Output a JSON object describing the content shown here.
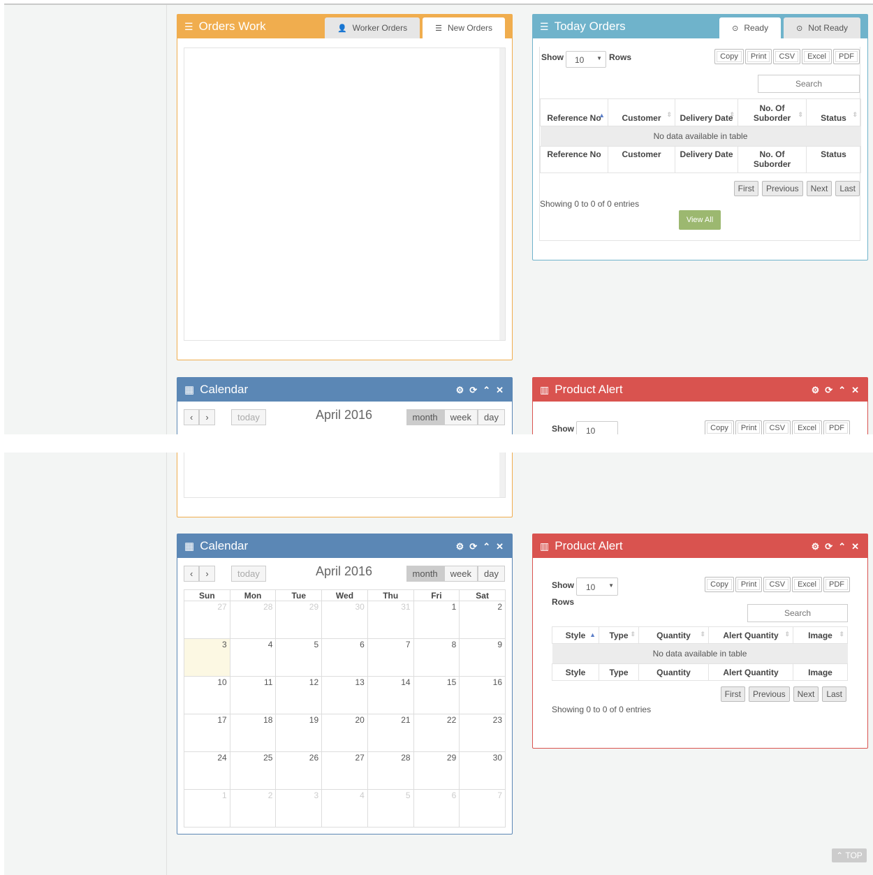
{
  "orders_work": {
    "title": "Orders Work",
    "tab_worker": "Worker Orders",
    "tab_new": "New Orders"
  },
  "today_orders": {
    "title": "Today Orders",
    "tab_ready": "Ready",
    "tab_not_ready": "Not Ready",
    "show_label": "Show",
    "rows_value": "10",
    "rows_label": "Rows",
    "buttons": [
      "Copy",
      "Print",
      "CSV",
      "Excel",
      "PDF"
    ],
    "search_placeholder": "Search",
    "columns": [
      "Reference No",
      "Customer",
      "Delivery Date",
      "No. Of Suborder",
      "Status"
    ],
    "empty_text": "No data available in table",
    "pager": [
      "First",
      "Previous",
      "Next",
      "Last"
    ],
    "info": "Showing 0 to 0 of 0 entries",
    "view_all": "View All"
  },
  "calendar": {
    "title": "Calendar",
    "today_btn": "today",
    "month_title": "April 2016",
    "views": [
      "month",
      "week",
      "day"
    ],
    "weekdays": [
      "Sun",
      "Mon",
      "Tue",
      "Wed",
      "Thu",
      "Fri",
      "Sat"
    ],
    "weeks": [
      [
        "27",
        "28",
        "29",
        "30",
        "31",
        "1",
        "2"
      ],
      [
        "3",
        "4",
        "5",
        "6",
        "7",
        "8",
        "9"
      ],
      [
        "10",
        "11",
        "12",
        "13",
        "14",
        "15",
        "16"
      ],
      [
        "17",
        "18",
        "19",
        "20",
        "21",
        "22",
        "23"
      ],
      [
        "24",
        "25",
        "26",
        "27",
        "28",
        "29",
        "30"
      ],
      [
        "1",
        "2",
        "3",
        "4",
        "5",
        "6",
        "7"
      ]
    ]
  },
  "product_alert": {
    "title": "Product Alert",
    "show_label": "Show",
    "rows_value": "10",
    "rows_label": "Rows",
    "buttons": [
      "Copy",
      "Print",
      "CSV",
      "Excel",
      "PDF"
    ],
    "search_placeholder": "Search",
    "columns": [
      "Style",
      "Type",
      "Quantity",
      "Alert Quantity",
      "Image"
    ],
    "empty_text": "No data available in table",
    "pager": [
      "First",
      "Previous",
      "Next",
      "Last"
    ],
    "info": "Showing 0 to 0 of 0 entries"
  },
  "top_button": "TOP",
  "colors": {
    "orange": "#f0ad4e",
    "teal": "#6fb3cb",
    "blue": "#5b87b5",
    "red": "#d9534f",
    "green": "#9cb870"
  }
}
